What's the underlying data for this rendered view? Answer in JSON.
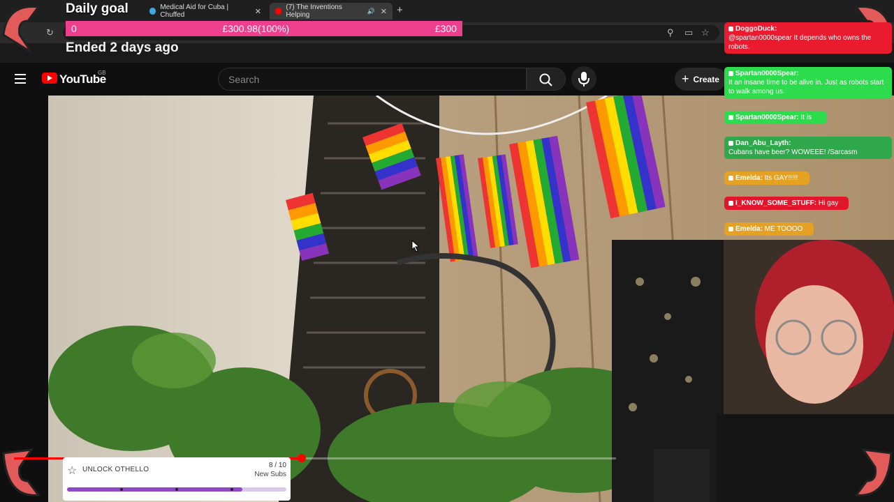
{
  "browser": {
    "tabs": [
      {
        "label": "Medical Aid for Cuba | Chuffed",
        "active": false
      },
      {
        "label": "(7) The Inventions Helping",
        "active": true
      }
    ],
    "new_tab_icon": "plus-icon"
  },
  "goal": {
    "title": "Daily goal",
    "start": "0",
    "current": "£300.98(100%)",
    "target": "£300",
    "status": "Ended 2 days ago",
    "color": "#ee3f8e"
  },
  "youtube": {
    "logo_text": "YouTube",
    "region": "GB",
    "search_placeholder": "Search",
    "create_label": "Create"
  },
  "video": {
    "progress_fraction": 0.478
  },
  "unlock_widget": {
    "title": "UNLOCK OTHELLO",
    "count": "8 / 10",
    "subtitle": "New Subs",
    "progress_fraction": 0.8,
    "accent": "#8f49c7"
  },
  "chat": [
    {
      "name": "DoggoDuck:",
      "text": "@spartan0000spear It depends who owns the robots.",
      "bg": "#ea1b2e"
    },
    {
      "name": "Spartan0000Spear:",
      "text": "It an insane time to be alive in. Just as robots start to walk among us.",
      "bg": "#2ddc4c"
    },
    {
      "name": "Spartan0000Spear:",
      "text": "It is",
      "bg": "#2ddc4c"
    },
    {
      "name": "Dan_Abu_Layth:",
      "text": "Cubans have beer? WOWEEE! /Sarcasm",
      "bg": "#2ea84a"
    },
    {
      "name": "Emelda:",
      "text": "Its GAY!!!!!",
      "bg": "#e5a123"
    },
    {
      "name": "I_KNOW_SOME_STUFF:",
      "text": "Hi gay",
      "bg": "#e1162b"
    },
    {
      "name": "Emelda:",
      "text": "ME TOOOO",
      "bg": "#e5a123"
    }
  ]
}
